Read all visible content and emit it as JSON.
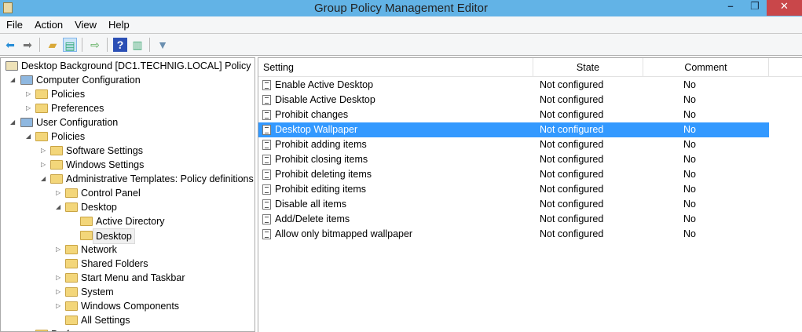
{
  "window": {
    "title": "Group Policy Management Editor",
    "minimize": "–",
    "restore": "❐",
    "close": "✕"
  },
  "menu": [
    "File",
    "Action",
    "View",
    "Help"
  ],
  "toolbar": {
    "icons": [
      "back-arrow-icon",
      "forward-arrow-icon",
      "up-folder-icon",
      "show-hide-tree-icon",
      "export-list-icon",
      "help-icon",
      "action-pane-icon",
      "filter-icon"
    ]
  },
  "tree": [
    {
      "label": "Desktop Background [DC1.TECHNIG.LOCAL] Policy",
      "level": 0,
      "exp": ""
    },
    {
      "label": "Computer Configuration",
      "level": 1,
      "exp": "◢"
    },
    {
      "label": "Policies",
      "level": 2,
      "exp": "▷"
    },
    {
      "label": "Preferences",
      "level": 2,
      "exp": "▷"
    },
    {
      "label": "User Configuration",
      "level": 1,
      "exp": "◢"
    },
    {
      "label": "Policies",
      "level": 2,
      "exp": "◢"
    },
    {
      "label": "Software Settings",
      "level": 3,
      "exp": "▷"
    },
    {
      "label": "Windows Settings",
      "level": 3,
      "exp": "▷"
    },
    {
      "label": "Administrative Templates: Policy definitions (",
      "level": 3,
      "exp": "◢"
    },
    {
      "label": "Control Panel",
      "level": 4,
      "exp": "▷"
    },
    {
      "label": "Desktop",
      "level": 4,
      "exp": "◢"
    },
    {
      "label": "Active Directory",
      "level": 5,
      "exp": ""
    },
    {
      "label": "Desktop",
      "level": 5,
      "exp": "",
      "selected": true
    },
    {
      "label": "Network",
      "level": 4,
      "exp": "▷"
    },
    {
      "label": "Shared Folders",
      "level": 4,
      "exp": ""
    },
    {
      "label": "Start Menu and Taskbar",
      "level": 4,
      "exp": "▷"
    },
    {
      "label": "System",
      "level": 4,
      "exp": "▷"
    },
    {
      "label": "Windows Components",
      "level": 4,
      "exp": "▷"
    },
    {
      "label": "All Settings",
      "level": 4,
      "exp": ""
    },
    {
      "label": "Preferences",
      "level": 2,
      "exp": "▷"
    }
  ],
  "list": {
    "columns": [
      "Setting",
      "State",
      "Comment"
    ],
    "rows": [
      {
        "setting": "Enable Active Desktop",
        "state": "Not configured",
        "comment": "No"
      },
      {
        "setting": "Disable Active Desktop",
        "state": "Not configured",
        "comment": "No"
      },
      {
        "setting": "Prohibit changes",
        "state": "Not configured",
        "comment": "No"
      },
      {
        "setting": "Desktop Wallpaper",
        "state": "Not configured",
        "comment": "No",
        "selected": true
      },
      {
        "setting": "Prohibit adding items",
        "state": "Not configured",
        "comment": "No"
      },
      {
        "setting": "Prohibit closing items",
        "state": "Not configured",
        "comment": "No"
      },
      {
        "setting": "Prohibit deleting items",
        "state": "Not configured",
        "comment": "No"
      },
      {
        "setting": "Prohibit editing items",
        "state": "Not configured",
        "comment": "No"
      },
      {
        "setting": "Disable all items",
        "state": "Not configured",
        "comment": "No"
      },
      {
        "setting": "Add/Delete items",
        "state": "Not configured",
        "comment": "No"
      },
      {
        "setting": "Allow only bitmapped wallpaper",
        "state": "Not configured",
        "comment": "No"
      }
    ]
  }
}
